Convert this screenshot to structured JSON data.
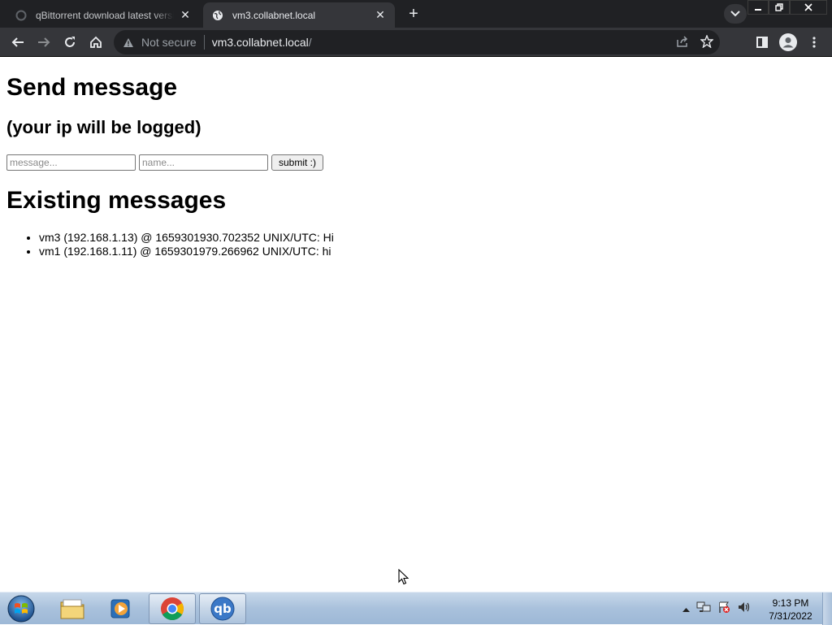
{
  "browser": {
    "tabs": [
      {
        "title": "qBittorrent download latest versi",
        "active": false
      },
      {
        "title": "vm3.collabnet.local",
        "active": true
      }
    ],
    "address": {
      "security": "Not secure",
      "host": "vm3.collabnet.local",
      "path": "/"
    }
  },
  "page": {
    "heading": "Send message",
    "subheading": "(your ip will be logged)",
    "form": {
      "message_placeholder": "message...",
      "name_placeholder": "name...",
      "submit_label": "submit :)"
    },
    "existing_heading": "Existing messages",
    "messages": [
      "vm3 (192.168.1.13) @ 1659301930.702352 UNIX/UTC: Hi",
      "vm1 (192.168.1.11) @ 1659301979.266962 UNIX/UTC: hi"
    ]
  },
  "taskbar": {
    "time": "9:13 PM",
    "date": "7/31/2022",
    "qbittorrent_label": "qb"
  },
  "colors": {
    "tabstrip": "#202124",
    "toolbar": "#35363a",
    "taskbar": "#a9c1dc"
  }
}
